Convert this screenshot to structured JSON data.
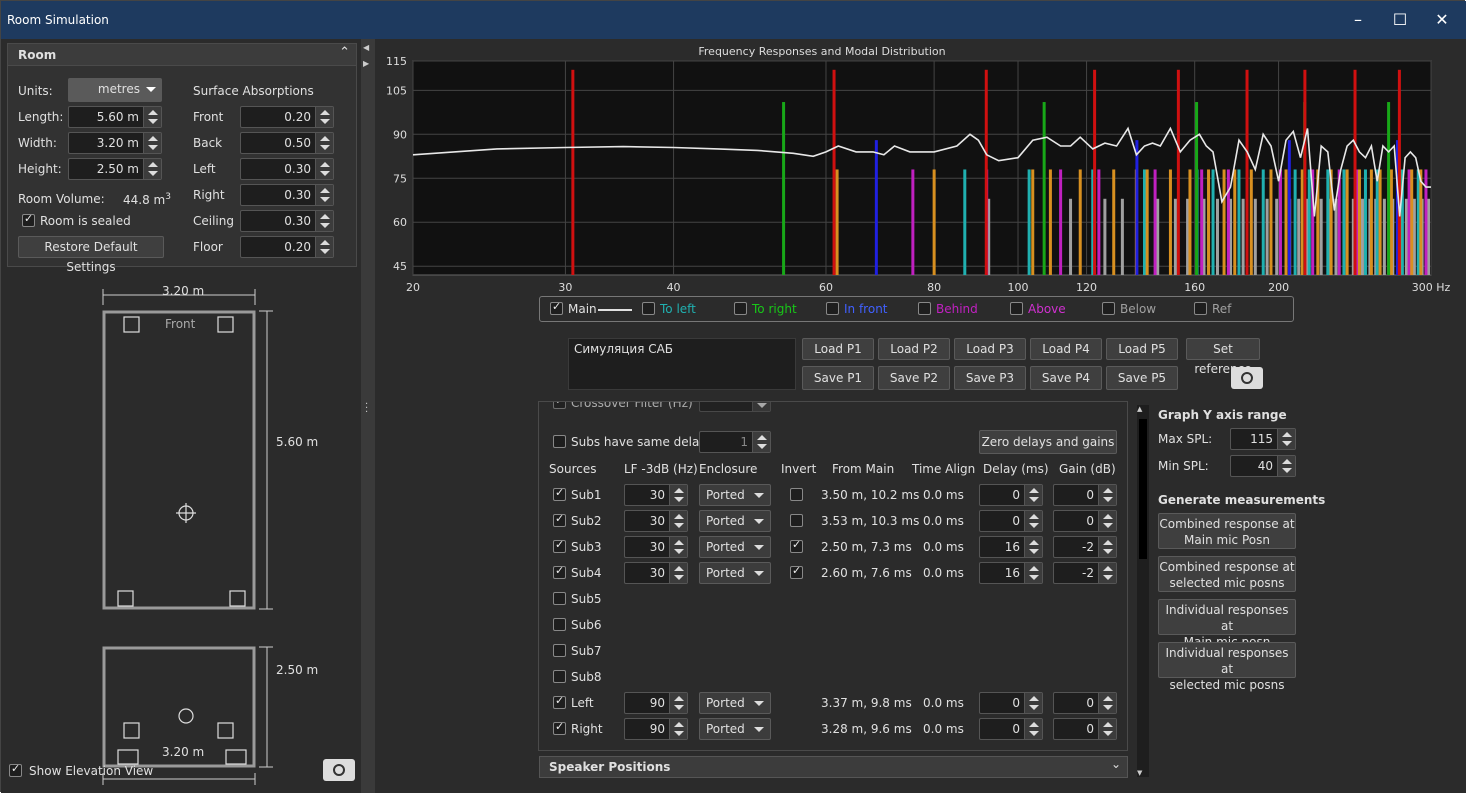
{
  "window": {
    "title": "Room Simulation"
  },
  "room": {
    "header": "Room",
    "units_label": "Units:",
    "units_value": "metres",
    "length_label": "Length:",
    "length_value": "5.60 m",
    "width_label": "Width:",
    "width_value": "3.20 m",
    "height_label": "Height:",
    "height_value": "2.50 m",
    "volume_label": "Room Volume:",
    "volume_value": "44.8 m",
    "volume_sup": "3",
    "sealed_label": "Room is sealed",
    "sealed": true,
    "restore_label": "Restore Default Settings",
    "absorption_header": "Surface Absorptions",
    "surfaces": [
      {
        "label": "Front",
        "value": "0.20"
      },
      {
        "label": "Back",
        "value": "0.50"
      },
      {
        "label": "Left",
        "value": "0.30"
      },
      {
        "label": "Right",
        "value": "0.30"
      },
      {
        "label": "Ceiling",
        "value": "0.30"
      },
      {
        "label": "Floor",
        "value": "0.20"
      }
    ]
  },
  "plan": {
    "width_dim": "3.20 m",
    "length_dim": "5.60 m",
    "front_label": "Front"
  },
  "elevation": {
    "height_dim": "2.50 m",
    "width_dim": "3.20 m"
  },
  "show_elevation": {
    "label": "Show Elevation View",
    "checked": true
  },
  "chart_data": {
    "type": "bar",
    "title": "Frequency Responses and Modal Distribution",
    "xlabel": "",
    "ylabel": "",
    "x_scale": "log",
    "xlim": [
      20,
      300
    ],
    "ylim": [
      42,
      115
    ],
    "x_ticks": [
      {
        "v": 20,
        "l": "20"
      },
      {
        "v": 30,
        "l": "30"
      },
      {
        "v": 40,
        "l": "40"
      },
      {
        "v": 60,
        "l": "60"
      },
      {
        "v": 80,
        "l": "80"
      },
      {
        "v": 100,
        "l": "100"
      },
      {
        "v": 120,
        "l": "120"
      },
      {
        "v": 160,
        "l": "160"
      },
      {
        "v": 200,
        "l": "200"
      },
      {
        "v": 300,
        "l": "300 Hz"
      }
    ],
    "y_ticks": [
      {
        "v": 115,
        "l": "115"
      },
      {
        "v": 105,
        "l": "105"
      },
      {
        "v": 90,
        "l": "90"
      },
      {
        "v": 75,
        "l": "75"
      },
      {
        "v": 60,
        "l": "60"
      },
      {
        "v": 45,
        "l": "45"
      }
    ],
    "grid": true,
    "modes": {
      "axial_red": {
        "color": "#d01010",
        "height": 112,
        "freqs": [
          30.6,
          61.3,
          91.9,
          122.6,
          153.2,
          183.9,
          214.5,
          245.1,
          275.8
        ]
      },
      "axial_green": {
        "color": "#18a818",
        "height": 101,
        "freqs": [
          53.6,
          107.2,
          160.8,
          214.4,
          268
        ]
      },
      "axial_blue": {
        "color": "#2020e0",
        "height": 88,
        "freqs": [
          68.6,
          137.2,
          205.8,
          274.4
        ]
      },
      "tangential_orange": {
        "color": "#d89020",
        "height": 78,
        "freqs": [
          61.8,
          80,
          104,
          109,
          118,
          129,
          137,
          141,
          150,
          158,
          166,
          173,
          178,
          186,
          196,
          204,
          213,
          222,
          230,
          240,
          248,
          256,
          262,
          270,
          276,
          285,
          292
        ]
      },
      "tangential_cyan": {
        "color": "#20b0b0",
        "height": 78,
        "freqs": [
          86.8,
          103,
          122,
          140,
          161,
          168,
          180,
          192,
          209,
          217,
          228,
          238,
          252,
          260,
          278,
          290
        ]
      },
      "tangential_magenta": {
        "color": "#c020c0",
        "height": 78,
        "freqs": [
          75.6,
          92,
          112,
          124,
          144,
          163,
          175,
          201,
          219,
          235,
          247,
          268,
          283,
          296
        ]
      },
      "oblique_grey": {
        "color": "#a0a0a0",
        "height": 68,
        "freqs": [
          92.5,
          115,
          126,
          132,
          145,
          152,
          157,
          164,
          170,
          176,
          182,
          188,
          194,
          199,
          206,
          211,
          216,
          224,
          229,
          233,
          238,
          244,
          250,
          255,
          259,
          265,
          271,
          276,
          281,
          287,
          293,
          298
        ]
      }
    },
    "series": [
      {
        "name": "Main",
        "color": "#e8e8e8",
        "x": [
          20,
          25,
          30,
          35,
          40,
          45,
          50,
          55,
          58,
          60,
          62,
          65,
          68,
          70,
          72,
          75,
          80,
          85,
          88,
          90,
          92,
          95,
          100,
          104,
          108,
          112,
          115,
          118,
          122,
          126,
          130,
          134,
          137,
          140,
          143,
          146,
          150,
          154,
          158,
          162,
          165,
          168,
          172,
          176,
          180,
          184,
          188,
          192,
          196,
          200,
          204,
          208,
          212,
          216,
          220,
          224,
          228,
          232,
          236,
          240,
          244,
          248,
          252,
          256,
          260,
          264,
          268,
          272,
          276,
          280,
          284,
          288,
          292,
          296,
          300
        ],
        "y": [
          83,
          85,
          85.5,
          85.8,
          85.5,
          85,
          84.5,
          83.5,
          82.5,
          84,
          86,
          84,
          84,
          83,
          86,
          84,
          84,
          86,
          90,
          88,
          83,
          81,
          82,
          88,
          89,
          86,
          86,
          89,
          85,
          87,
          86,
          92,
          83,
          86,
          87,
          86,
          92,
          84,
          88,
          90,
          86,
          84,
          67,
          72,
          88,
          84,
          78,
          90,
          86,
          74,
          88,
          91,
          82,
          92,
          62,
          86,
          84,
          64,
          78,
          86,
          88,
          84,
          82,
          86,
          74,
          86,
          84,
          86,
          62,
          82,
          84,
          82,
          74,
          72,
          72
        ]
      }
    ]
  },
  "legend": [
    {
      "label": "Main",
      "color": "#e0e0e0",
      "checked": true,
      "line": true
    },
    {
      "label": "To left",
      "color": "#20b0b0",
      "checked": false
    },
    {
      "label": "To right",
      "color": "#18c818",
      "checked": false
    },
    {
      "label": "In front",
      "color": "#4060ff",
      "checked": false
    },
    {
      "label": "Behind",
      "color": "#c020c0",
      "checked": false
    },
    {
      "label": "Above",
      "color": "#d030d0",
      "checked": false
    },
    {
      "label": "Below",
      "color": "#a0a0a0",
      "checked": false
    },
    {
      "label": "Ref",
      "color": "#a0a0a0",
      "checked": false
    }
  ],
  "presets": {
    "note": "Симуляция САБ",
    "load": [
      "Load P1",
      "Load P2",
      "Load P3",
      "Load P4",
      "Load P5"
    ],
    "save": [
      "Save P1",
      "Save P2",
      "Save P3",
      "Save P4",
      "Save P5"
    ],
    "set_reference": "Set reference"
  },
  "sources": {
    "partial_row": "Crossover Filter (Hz)",
    "same_delay_label": "Subs have same delay",
    "same_delay_value": "1",
    "zero_button": "Zero delays and gains",
    "headers": [
      "Sources",
      "LF -3dB (Hz)",
      "Enclosure",
      "Invert",
      "From Main",
      "Time Align",
      "Delay (ms)",
      "Gain (dB)"
    ],
    "rows": [
      {
        "name": "Sub1",
        "on": true,
        "lf": "30",
        "enc": "Ported",
        "invert": false,
        "from": "3.50 m, 10.2 ms",
        "align": "0.0 ms",
        "delay": "0",
        "gain": "0"
      },
      {
        "name": "Sub2",
        "on": true,
        "lf": "30",
        "enc": "Ported",
        "invert": false,
        "from": "3.53 m, 10.3 ms",
        "align": "0.0 ms",
        "delay": "0",
        "gain": "0"
      },
      {
        "name": "Sub3",
        "on": true,
        "lf": "30",
        "enc": "Ported",
        "invert": true,
        "from": "2.50 m, 7.3 ms",
        "align": "0.0 ms",
        "delay": "16",
        "gain": "-2"
      },
      {
        "name": "Sub4",
        "on": true,
        "lf": "30",
        "enc": "Ported",
        "invert": true,
        "from": "2.60 m, 7.6 ms",
        "align": "0.0 ms",
        "delay": "16",
        "gain": "-2"
      },
      {
        "name": "Sub5",
        "on": false
      },
      {
        "name": "Sub6",
        "on": false
      },
      {
        "name": "Sub7",
        "on": false
      },
      {
        "name": "Sub8",
        "on": false
      },
      {
        "name": "Left",
        "on": true,
        "lf": "90",
        "enc": "Ported",
        "from": "3.37 m, 9.8 ms",
        "align": "0.0 ms",
        "delay": "0",
        "gain": "0"
      },
      {
        "name": "Right",
        "on": true,
        "lf": "90",
        "enc": "Ported",
        "from": "3.28 m, 9.6 ms",
        "align": "0.0 ms",
        "delay": "0",
        "gain": "0"
      }
    ]
  },
  "speaker_positions": {
    "label": "Speaker Positions"
  },
  "graph_range": {
    "header": "Graph Y axis range",
    "max_label": "Max SPL:",
    "max_value": "115",
    "min_label": "Min SPL:",
    "min_value": "40"
  },
  "generate": {
    "header": "Generate measurements",
    "buttons": [
      [
        "Combined response at",
        "Main mic Posn"
      ],
      [
        "Combined response at",
        "selected mic posns"
      ],
      [
        "Individual responses at",
        "Main mic posn"
      ],
      [
        "Individual responses at",
        "selected mic posns"
      ]
    ]
  }
}
